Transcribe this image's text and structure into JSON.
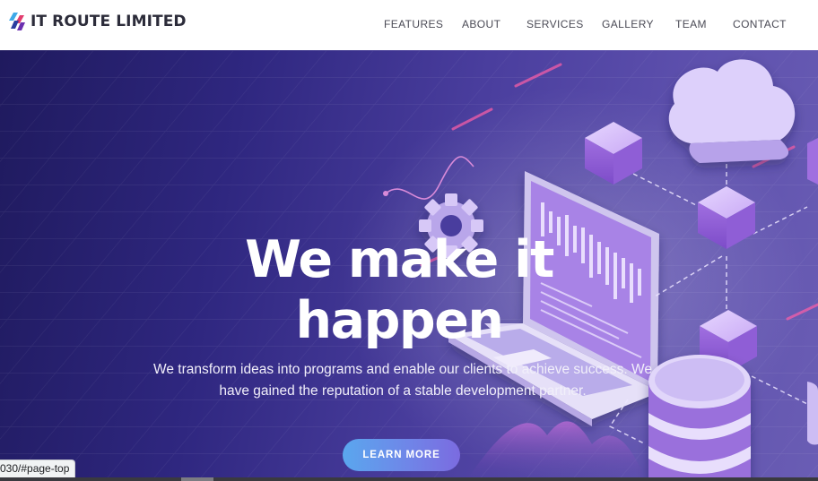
{
  "header": {
    "brand_name": "IT ROUTE LIMITED",
    "brand_icon": "logo-mark",
    "nav": [
      {
        "label": "FEATURES"
      },
      {
        "label": "ABOUT"
      },
      {
        "label": "SERVICES"
      },
      {
        "label": "GALLERY"
      },
      {
        "label": "TEAM"
      },
      {
        "label": "CONTACT"
      }
    ]
  },
  "hero": {
    "title": "We make it happen",
    "text": "We transform ideas into programs and enable our clients to achieve success. We have gained the reputation of a stable development partner.",
    "cta_label": "LEARN MORE"
  },
  "status_bar": {
    "url": "030/#page-top"
  },
  "colors": {
    "hero_dark": "#1f1a5e",
    "hero_light": "#6a5db4",
    "cta_start": "#5aa7ee",
    "cta_end": "#7b6be0",
    "accent_purple": "#a06fe0"
  }
}
